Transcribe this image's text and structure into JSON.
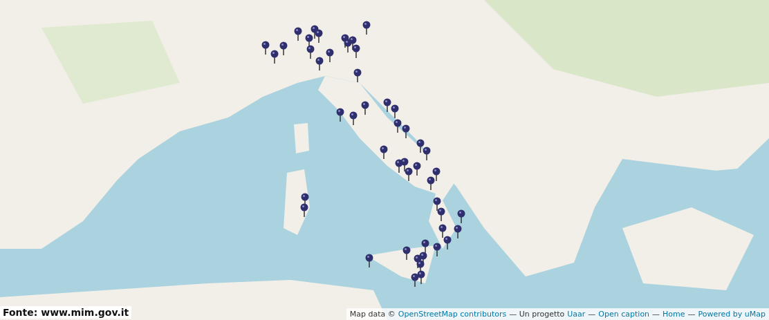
{
  "caption": "Fonte: www.mim.gov.it",
  "attribution": [
    {
      "kind": "text",
      "text": "Map data ©"
    },
    {
      "kind": "link",
      "text": "OpenStreetMap contributors"
    },
    {
      "kind": "text",
      "text": "— Un progetto"
    },
    {
      "kind": "link",
      "text": "Uaar"
    },
    {
      "kind": "text",
      "text": "—"
    },
    {
      "kind": "link",
      "text": "Open caption"
    },
    {
      "kind": "text",
      "text": "—"
    },
    {
      "kind": "link",
      "text": "Home"
    },
    {
      "kind": "text",
      "text": "—"
    },
    {
      "kind": "link",
      "text": "Powered by uMap"
    }
  ]
}
